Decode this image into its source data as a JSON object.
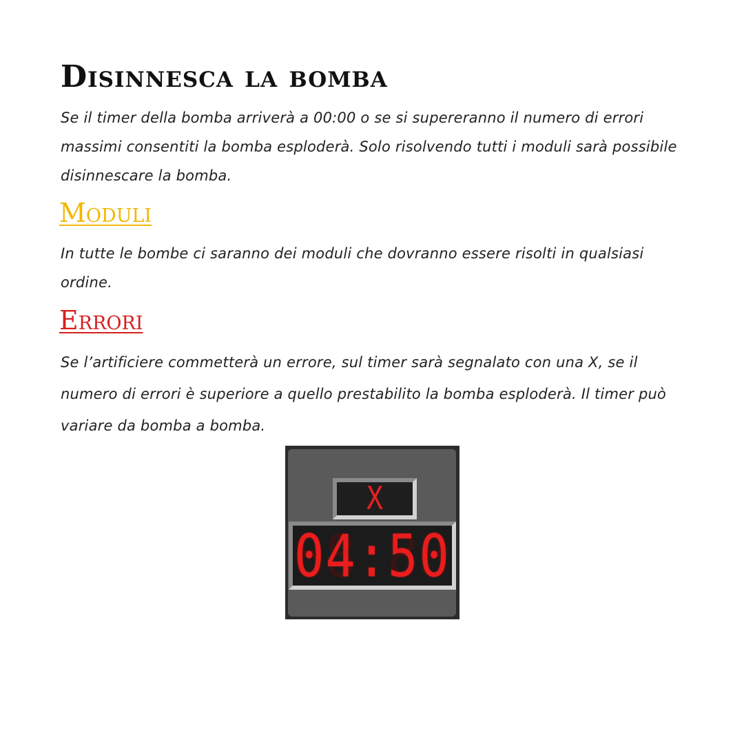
{
  "document": {
    "title": "Disinnesca la bomba",
    "intro": "Se il timer della bomba arriverà a 00:00 o se si supereranno il numero di errori massimi consentiti la bomba esploderà. Solo risolvendo tutti i moduli sarà possibile disinnescare la bomba.",
    "sections": [
      {
        "heading": "Moduli",
        "color": "#f2b705",
        "body": "In tutte le bombe ci saranno dei moduli che dovranno essere risolti in qualsiasi ordine."
      },
      {
        "heading": "Errori",
        "color": "#d81e1e",
        "body": "Se l’artificiere commetterà un errore, sul timer sarà segnalato con una X, se il numero di errori è superiore a quello prestabilito la bomba esploderà. Il timer può variare da bomba a bomba."
      }
    ]
  },
  "timer": {
    "strike": "X",
    "time": "04:50",
    "ghost": "88:88",
    "digit_color": "#ea1c1c",
    "panel_color": "#5a5a5a"
  }
}
